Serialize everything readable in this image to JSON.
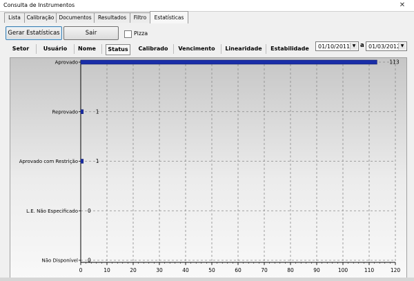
{
  "window": {
    "title": "Consulta de Instrumentos",
    "close_glyph": "✕"
  },
  "tabs": [
    "Lista",
    "Calibração",
    "Documentos",
    "Resultados",
    "Filtro",
    "Estatísticas"
  ],
  "active_tab": "Estatísticas",
  "buttons": {
    "gerar": "Gerar Estatísticas",
    "sair": "Sair"
  },
  "pizza": {
    "label": "Pizza",
    "checked": false
  },
  "filters": [
    "Setor",
    "Usuário",
    "Nome",
    "Status",
    "Calibrado",
    "Vencimento",
    "Linearidade",
    "Estabilidade"
  ],
  "active_filter": "Status",
  "dates": {
    "from": "01/10/2011",
    "connector": "a",
    "to": "01/03/2012"
  },
  "chart_data": {
    "type": "bar",
    "orientation": "horizontal",
    "categories": [
      "Aprovado",
      "Reprovado",
      "Aprovado com Restrição",
      "L.E. Não Especificado",
      "Não Disponível"
    ],
    "values": [
      113,
      1,
      1,
      0,
      0
    ],
    "xlim": [
      0,
      120
    ],
    "xticks": [
      0,
      10,
      20,
      30,
      40,
      50,
      60,
      70,
      80,
      90,
      100,
      110,
      120
    ],
    "grid": true,
    "bar_color": "#1a2ea8"
  }
}
